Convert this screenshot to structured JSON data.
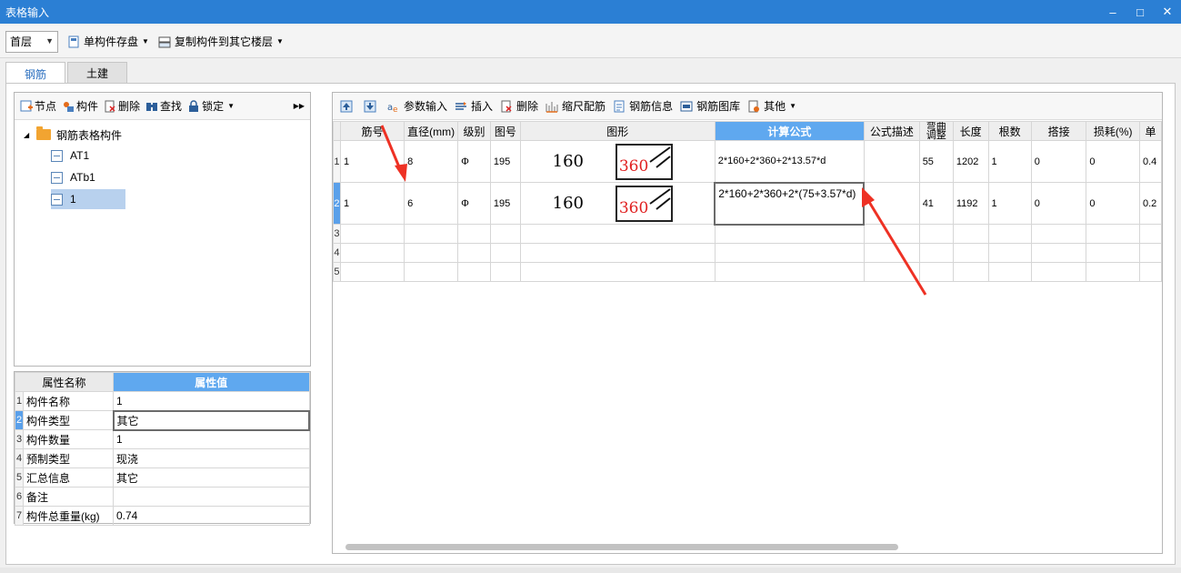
{
  "window": {
    "title": "表格输入",
    "minimize": "–",
    "maximize": "□",
    "close": "✕"
  },
  "toolbar": {
    "floor_value": "首层",
    "save_label": "单构件存盘",
    "copy_label": "复制构件到其它楼层"
  },
  "tabs": [
    {
      "label": "钢筋",
      "active": true
    },
    {
      "label": "土建",
      "active": false
    }
  ],
  "left_toolbar": {
    "node": "节点",
    "component": "构件",
    "delete": "删除",
    "find": "查找",
    "lock": "锁定"
  },
  "tree": {
    "root": "钢筋表格构件",
    "items": [
      "AT1",
      "ATb1",
      "1"
    ],
    "selected_index": 2
  },
  "attributes": {
    "header_name": "属性名称",
    "header_value": "属性值",
    "rows": [
      {
        "idx": "1",
        "name": "构件名称",
        "value": "1"
      },
      {
        "idx": "2",
        "name": "构件类型",
        "value": "其它"
      },
      {
        "idx": "3",
        "name": "构件数量",
        "value": "1"
      },
      {
        "idx": "4",
        "name": "预制类型",
        "value": "现浇"
      },
      {
        "idx": "5",
        "name": "汇总信息",
        "value": "其它"
      },
      {
        "idx": "6",
        "name": "备注",
        "value": ""
      },
      {
        "idx": "7",
        "name": "构件总重量(kg)",
        "value": "0.74"
      }
    ]
  },
  "right_toolbar": {
    "param_input": "参数输入",
    "insert": "插入",
    "delete": "删除",
    "scale": "缩尺配筋",
    "rebar_info": "钢筋信息",
    "rebar_lib": "钢筋图库",
    "other": "其他"
  },
  "grid": {
    "headers": [
      "筋号",
      "直径(mm)",
      "级别",
      "图号",
      "图形",
      "计算公式",
      "公式描述",
      "弯曲调整",
      "长度",
      "根数",
      "搭接",
      "损耗(%)",
      "单"
    ],
    "rows": [
      {
        "rn": "1",
        "bar": "1",
        "dia": "8",
        "grade": "Φ",
        "fig": "195",
        "shape_a": "160",
        "shape_b": "360",
        "formula": "2*160+2*360+2*13.57*d",
        "desc": "",
        "bend": "55",
        "length": "1202",
        "count": "1",
        "lap": "0",
        "loss": "0",
        "unit": "0.4"
      },
      {
        "rn": "2",
        "bar": "1",
        "dia": "6",
        "grade": "Φ",
        "fig": "195",
        "shape_a": "160",
        "shape_b": "360",
        "formula": "2*160+2*360+2*(75+3.57*d)",
        "desc": "",
        "bend": "41",
        "length": "1192",
        "count": "1",
        "lap": "0",
        "loss": "0",
        "unit": "0.2"
      },
      {
        "rn": "3"
      },
      {
        "rn": "4"
      },
      {
        "rn": "5"
      }
    ]
  },
  "colors": {
    "titlebar": "#2b7fd4",
    "header_highlight": "#5fa8ef",
    "annotation_arrow": "#ee3124",
    "shape_label": "#e02020"
  }
}
